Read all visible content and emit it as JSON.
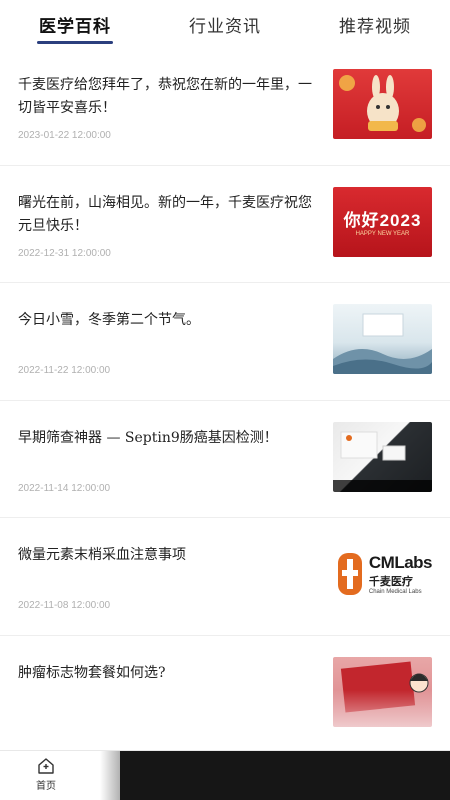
{
  "tabs": [
    {
      "label": "医学百科",
      "active": true
    },
    {
      "label": "行业资讯",
      "active": false
    },
    {
      "label": "推荐视频",
      "active": false
    }
  ],
  "articles": [
    {
      "title": "千麦医疗给您拜年了，恭祝您在新的一年里，一切皆平安喜乐！",
      "date": "2023-01-22 12:00:00",
      "thumb_icon": "new-year-rabbit-image"
    },
    {
      "title": "曙光在前，山海相见。新的一年，千麦医疗祝您元旦快乐！",
      "date": "2022-12-31 12:00:00",
      "thumb_icon": "hello-2023-image",
      "thumb_text": "你好2023",
      "thumb_sub": "HAPPY NEW YEAR"
    },
    {
      "title": "今日小雪，冬季第二个节气。",
      "date": "2022-11-22 12:00:00",
      "thumb_icon": "light-snow-image"
    },
    {
      "title": "早期筛查神器 — Septin9肠癌基因检测！",
      "date": "2022-11-14 12:00:00",
      "thumb_icon": "septin9-product-image"
    },
    {
      "title": "微量元素末梢采血注意事项",
      "date": "2022-11-08 12:00:00",
      "thumb_icon": "cmlabs-logo-image",
      "logo_en": "CMLabs",
      "logo_cn": "千麦医疗",
      "logo_sub": "Chain Medical Labs"
    },
    {
      "title": "肿瘤标志物套餐如何选?",
      "date": "",
      "thumb_icon": "tumor-marker-image"
    }
  ],
  "bottom_nav": {
    "home_label": "首页",
    "home_icon": "home-icon"
  },
  "colors": {
    "accent": "#2b3f7e",
    "date_gray": "#b0b0b0"
  }
}
